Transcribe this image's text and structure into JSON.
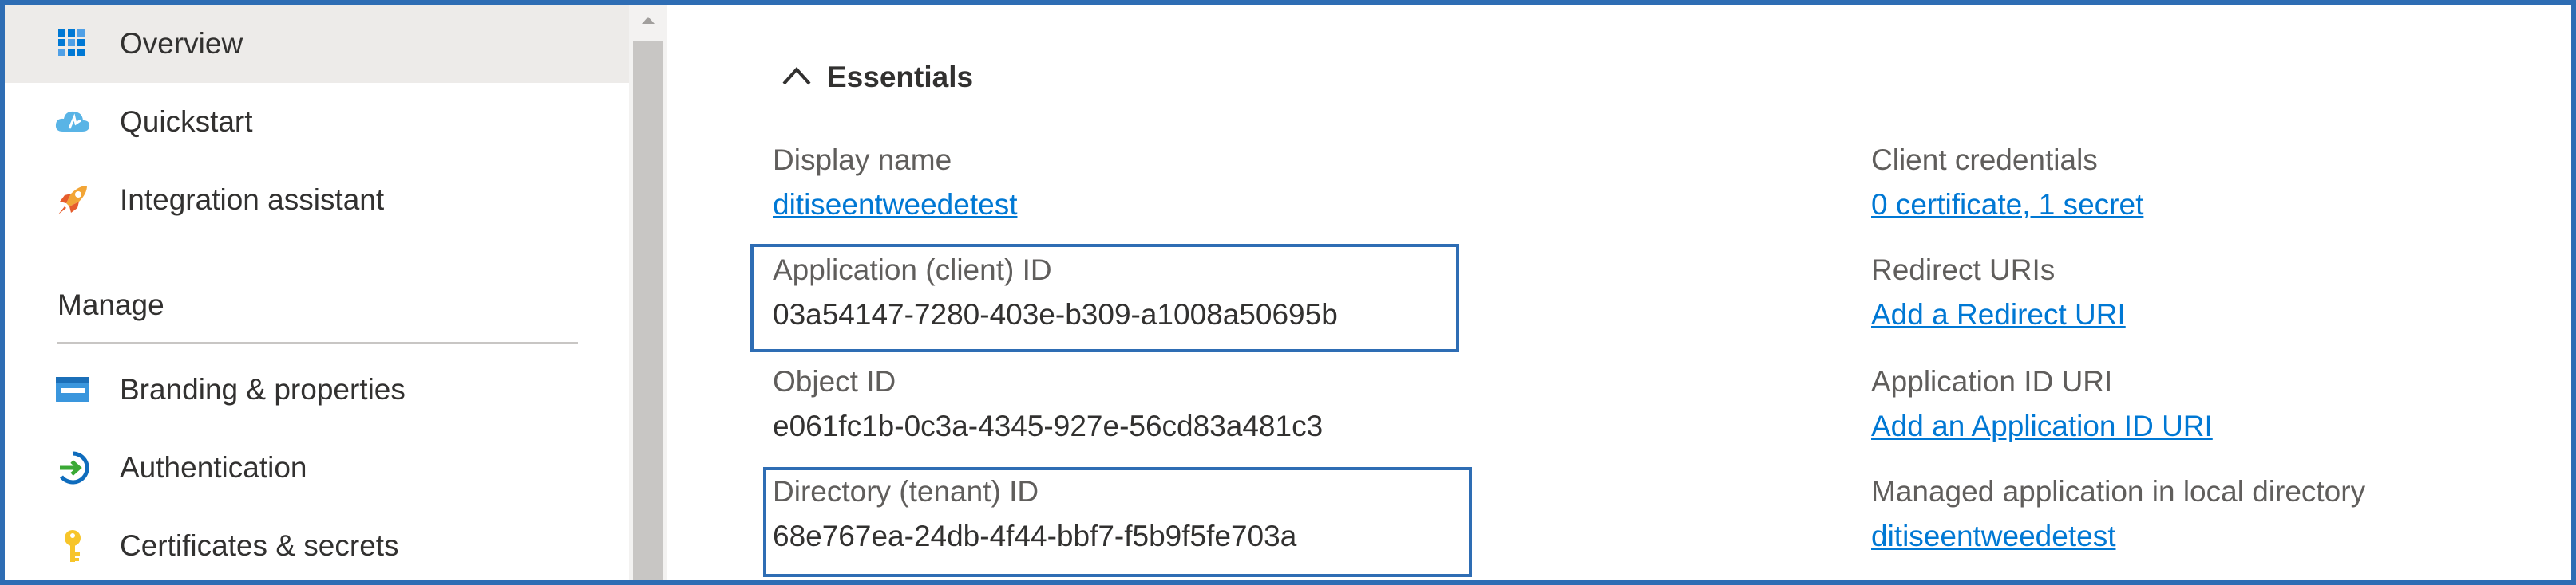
{
  "sidebar": {
    "items": [
      {
        "label": "Overview",
        "icon": "overview-grid-icon",
        "selected": true
      },
      {
        "label": "Quickstart",
        "icon": "quickstart-cloud-icon"
      },
      {
        "label": "Integration assistant",
        "icon": "rocket-icon"
      }
    ],
    "manage_heading": "Manage",
    "manage_items": [
      {
        "label": "Branding & properties",
        "icon": "branding-card-icon"
      },
      {
        "label": "Authentication",
        "icon": "authentication-icon"
      },
      {
        "label": "Certificates & secrets",
        "icon": "key-icon"
      }
    ]
  },
  "essentials": {
    "title": "Essentials",
    "left": [
      {
        "label": "Display name",
        "value": "ditiseentweedetest",
        "link": true
      },
      {
        "label": "Application (client) ID",
        "value": "03a54147-7280-403e-b309-a1008a50695b",
        "highlighted": true
      },
      {
        "label": "Object ID",
        "value": "e061fc1b-0c3a-4345-927e-56cd83a481c3"
      },
      {
        "label": "Directory (tenant) ID",
        "value": "68e767ea-24db-4f44-bbf7-f5b9f5fe703a",
        "highlighted": true
      }
    ],
    "right": [
      {
        "label": "Client credentials",
        "value": "0 certificate, 1 secret",
        "link": true
      },
      {
        "label": "Redirect URIs",
        "value": "Add a Redirect URI",
        "link": true
      },
      {
        "label": "Application ID URI",
        "value": "Add an Application ID URI",
        "link": true
      },
      {
        "label": "Managed application in local directory",
        "value": "ditiseentweedetest",
        "link": true
      }
    ]
  },
  "colors": {
    "accent": "#0078d4",
    "frame_border": "#2e6db4",
    "selected_bg": "#edebe9"
  }
}
